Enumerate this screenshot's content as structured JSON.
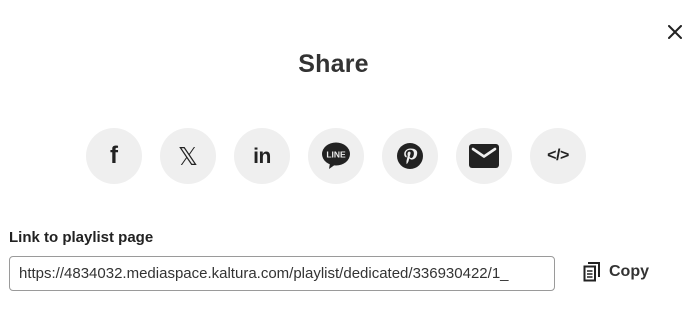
{
  "dialog": {
    "title": "Share",
    "close_icon": "close-icon"
  },
  "socials": [
    {
      "name": "facebook",
      "glyph": "f"
    },
    {
      "name": "x-twitter",
      "glyph": "𝕏"
    },
    {
      "name": "linkedin",
      "glyph": "in"
    },
    {
      "name": "line",
      "glyph": "LINE"
    },
    {
      "name": "pinterest",
      "glyph": "pinterest-icon"
    },
    {
      "name": "email",
      "glyph": "envelope-icon"
    },
    {
      "name": "embed",
      "glyph": "</>"
    }
  ],
  "link": {
    "label": "Link to playlist page",
    "value": "https://4834032.mediaspace.kaltura.com/playlist/dedicated/336930422/1_"
  },
  "copy": {
    "label": "Copy",
    "icon": "copy-icon"
  }
}
